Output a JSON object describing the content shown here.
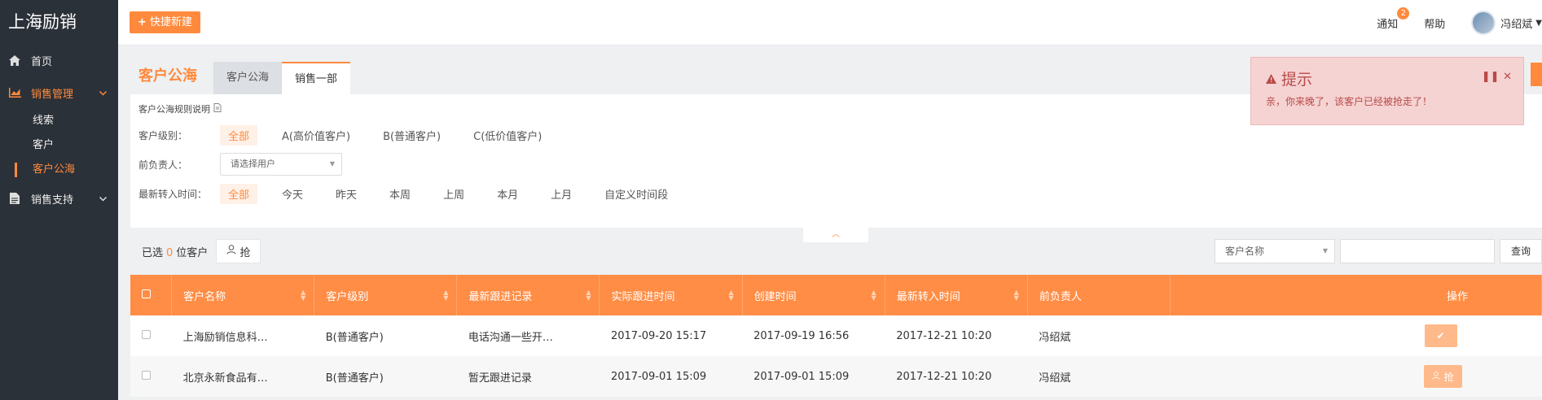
{
  "app": {
    "brand": "上海励销"
  },
  "sidebar": {
    "items": [
      {
        "label": "首页",
        "icon": "home-icon"
      },
      {
        "label": "销售管理",
        "icon": "chart-icon",
        "active": true,
        "children": [
          {
            "label": "线索"
          },
          {
            "label": "客户"
          },
          {
            "label": "客户公海",
            "active": true
          }
        ]
      },
      {
        "label": "销售支持",
        "icon": "file-icon"
      }
    ]
  },
  "topbar": {
    "quick_create": "快捷新建",
    "notify": "通知",
    "notify_count": "2",
    "help": "帮助",
    "user_name": "冯绍斌"
  },
  "page": {
    "title": "客户公海",
    "tabs": [
      {
        "label": "客户公海"
      },
      {
        "label": "销售一部",
        "active": true
      }
    ]
  },
  "filters": {
    "rules_link": "客户公海规则说明",
    "level_label": "客户级别：",
    "levels": [
      "全部",
      "A(高价值客户)",
      "B(普通客户)",
      "C(低价值客户)"
    ],
    "owner_label": "前负责人：",
    "owner_placeholder": "请选择用户",
    "time_label": "最新转入时间：",
    "times": [
      "全部",
      "今天",
      "昨天",
      "本周",
      "上周",
      "本月",
      "上月",
      "自定义时间段"
    ]
  },
  "toolbar": {
    "selected_prefix": "已选",
    "selected_count": "0",
    "selected_suffix": "位客户",
    "grab_label": "抢",
    "search_field": "客户名称",
    "search_value": "",
    "search_button": "查询"
  },
  "table": {
    "headers": [
      "客户名称",
      "客户级别",
      "最新跟进记录",
      "实际跟进时间",
      "创建时间",
      "最新转入时间",
      "前负责人",
      "操作"
    ],
    "rows": [
      {
        "name": "上海励销信息科…",
        "level": "B(普通客户)",
        "record": "电话沟通一些开…",
        "follow_time": "2017-09-20 15:17",
        "created": "2017-09-19 16:56",
        "transfer": "2017-12-21 10:20",
        "owner": "冯绍斌",
        "op": "✔"
      },
      {
        "name": "北京永新食品有…",
        "level": "B(普通客户)",
        "record": "暂无跟进记录",
        "follow_time": "2017-09-01 15:09",
        "created": "2017-09-01 15:09",
        "transfer": "2017-12-21 10:20",
        "owner": "冯绍斌",
        "op": "抢"
      }
    ]
  },
  "alert": {
    "title": "提示",
    "message": "亲，你来晚了，该客户已经被抢走了！"
  },
  "colors": {
    "accent": "#ff8a3d",
    "sidebar_bg": "#2b3138",
    "alert_bg": "#f5d3d3"
  }
}
